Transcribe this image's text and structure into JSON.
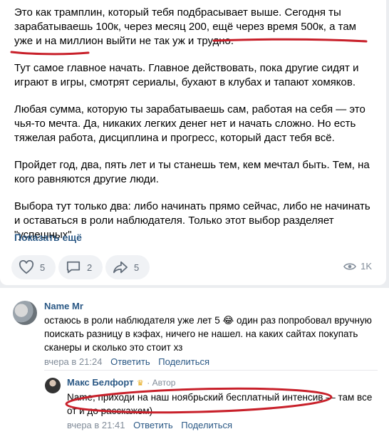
{
  "post": {
    "paragraphs": [
      "Это как трамплин, который тебя подбрасывает выше. Сегодня ты зарабатываешь 100к, через месяц 200, ещё через время 500к, а там уже и на миллион выйти не так уж и трудно.",
      "Тут самое главное начать. Главное действовать, пока другие сидят и играют в игры, смотрят сериалы, бухают в клубах и тапают хомяков.",
      "Любая сумма, которую ты зарабатываешь сам, работая на себя — это чья-то мечта. Да, никаких легких денег нет и начать сложно. Но есть тяжелая работа, дисциплина и прогресс, который даст тебя всё.",
      "Пройдет год, два, пять лет и ты станешь тем, кем мечтал быть. Тем, на кого равняются другие люди.",
      "Выбора тут только два: либо начинать прямо сейчас, либо не начинать и оставаться в роли наблюдателя. Только этот выбор разделяет \"успешных\""
    ],
    "show_more": "Показать ещё"
  },
  "actions": {
    "likes": "5",
    "comments": "2",
    "shares": "5",
    "views": "1K"
  },
  "comments": [
    {
      "author": "Name Mr",
      "text": "остаюсь в роли наблюдателя уже лет 5 😂 один раз попробовал вручную поискать разницу в кэфах, ничего не нашел. на каких сайтах покупать сканеры и сколько это стоит хз",
      "time": "вчера в 21:24",
      "reply": "Ответить",
      "share": "Поделиться"
    },
    {
      "author": "Макс Белфорт",
      "badge": "· Автор",
      "text": "Name, приходи на наш ноябрьский бесплатный интенсив — там все от и до расскажем)",
      "time": "вчера в 21:41",
      "reply": "Ответить",
      "share": "Поделиться"
    }
  ],
  "colors": {
    "link": "#2a5885",
    "muted": "#818c99",
    "annotation": "#c8202a"
  }
}
